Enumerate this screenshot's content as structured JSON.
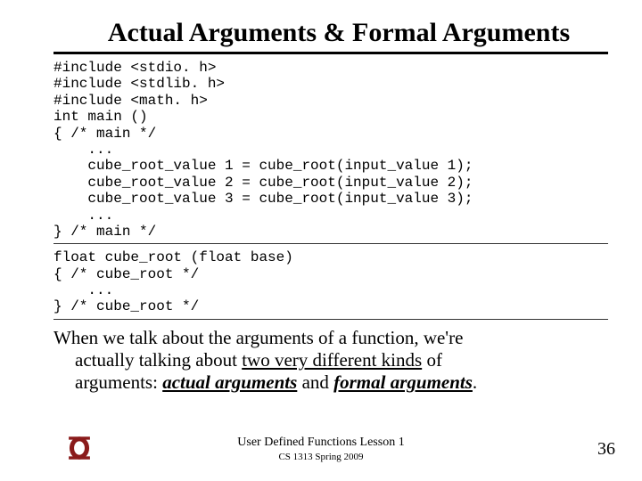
{
  "title": "Actual Arguments & Formal Arguments",
  "code1": "#include <stdio. h>\n#include <stdlib. h>\n#include <math. h>\nint main ()\n{ /* main */\n    ...\n    cube_root_value 1 = cube_root(input_value 1);\n    cube_root_value 2 = cube_root(input_value 2);\n    cube_root_value 3 = cube_root(input_value 3);\n    ...\n} /* main */",
  "code2": "float cube_root (float base)\n{ /* cube_root */\n    ...\n} /* cube_root */",
  "body": {
    "line1": "When we talk about the arguments of a function, we're",
    "line2a": "actually talking about ",
    "line2b": "two very different kinds",
    "line2c": " of",
    "line3a": "arguments: ",
    "line3b": "actual arguments",
    "line3c": " and ",
    "line3d": "formal arguments",
    "line3e": "."
  },
  "footer": {
    "lesson": "User Defined Functions Lesson 1",
    "course": "CS 1313 Spring 2009",
    "page": "36"
  }
}
